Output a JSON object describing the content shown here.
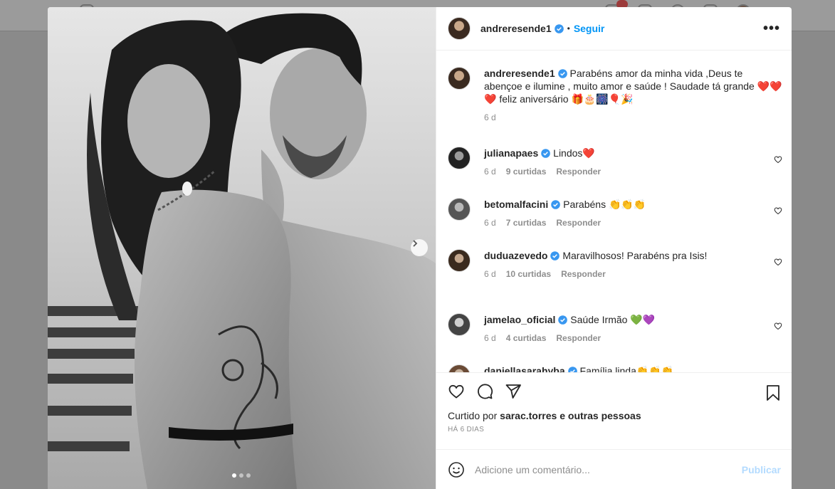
{
  "post": {
    "author": "andreresende1",
    "follow_label": "Seguir",
    "separator": "•",
    "more_label": "•••",
    "caption": "Parabéns amor da minha vida ,Deus te abençoe e ilumine , muito amor e saúde ! Saudade tá grande ❤️❤️❤️ feliz aniversário 🎁🎂🎆🎈🎉",
    "caption_age": "6 d",
    "carousel": {
      "count": 3,
      "active": 0
    }
  },
  "comments": [
    {
      "user": "julianapaes",
      "text": "Lindos❤️",
      "age": "6 d",
      "likes": "9 curtidas",
      "reply": "Responder"
    },
    {
      "user": "betomalfacini",
      "text": "Parabéns 👏👏👏",
      "age": "6 d",
      "likes": "7 curtidas",
      "reply": "Responder"
    },
    {
      "user": "duduazevedo",
      "text": "Maravilhosos! Parabéns pra Isis!",
      "age": "6 d",
      "likes": "10 curtidas",
      "reply": "Responder"
    },
    {
      "user": "jamelao_oficial",
      "text": "Saúde Irmão 💚💜",
      "age": "6 d",
      "likes": "4 curtidas",
      "reply": "Responder"
    },
    {
      "user": "daniellasarahyba",
      "text": "Família linda👏👏👏",
      "age": "",
      "likes": "",
      "reply": ""
    }
  ],
  "likes": {
    "prefix": "Curtido por",
    "user": "sarac.torres",
    "suffix": "e outras pessoas"
  },
  "date": "HÁ 6 DIAS",
  "add_comment": {
    "placeholder": "Adicione um comentário...",
    "publish": "Publicar"
  },
  "colors": {
    "accent": "#0095f6",
    "publish_disabled": "#b3dbff",
    "verified": "#3897f0",
    "heart": "#ed4956"
  },
  "icons": [
    "like-icon",
    "comment-icon",
    "share-icon",
    "save-icon",
    "emoji-icon",
    "verified-icon",
    "chevron-right-icon",
    "more-icon",
    "heart-icon"
  ]
}
